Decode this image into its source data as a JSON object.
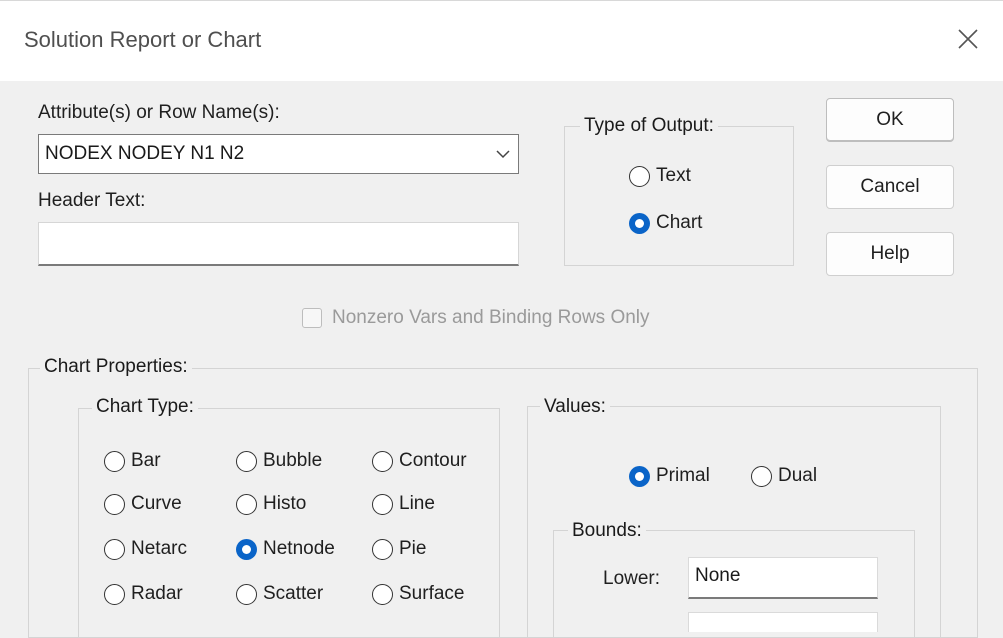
{
  "window": {
    "title": "Solution Report or Chart"
  },
  "attributes": {
    "label": "Attribute(s) or Row Name(s):",
    "value": "NODEX NODEY N1 N2"
  },
  "header_text": {
    "label": "Header Text:",
    "value": ""
  },
  "output_type": {
    "label": "Type of Output:",
    "options": [
      {
        "label": "Text",
        "selected": false
      },
      {
        "label": "Chart",
        "selected": true
      }
    ]
  },
  "buttons": {
    "ok": "OK",
    "cancel": "Cancel",
    "help": "Help"
  },
  "nonzero_checkbox": {
    "label": "Nonzero Vars and Binding Rows Only",
    "checked": false,
    "enabled": false
  },
  "chart_properties": {
    "label": "Chart Properties:",
    "chart_type": {
      "label": "Chart Type:",
      "options": [
        "Bar",
        "Bubble",
        "Contour",
        "Curve",
        "Histo",
        "Line",
        "Netarc",
        "Netnode",
        "Pie",
        "Radar",
        "Scatter",
        "Surface"
      ],
      "selected": "Netnode"
    },
    "values": {
      "label": "Values:",
      "options": [
        "Primal",
        "Dual"
      ],
      "selected": "Primal",
      "bounds": {
        "label": "Bounds:",
        "lower_label": "Lower:",
        "lower_value": "None"
      }
    }
  },
  "colors": {
    "accent": "#0a64c8",
    "background": "#f0f0f0"
  }
}
